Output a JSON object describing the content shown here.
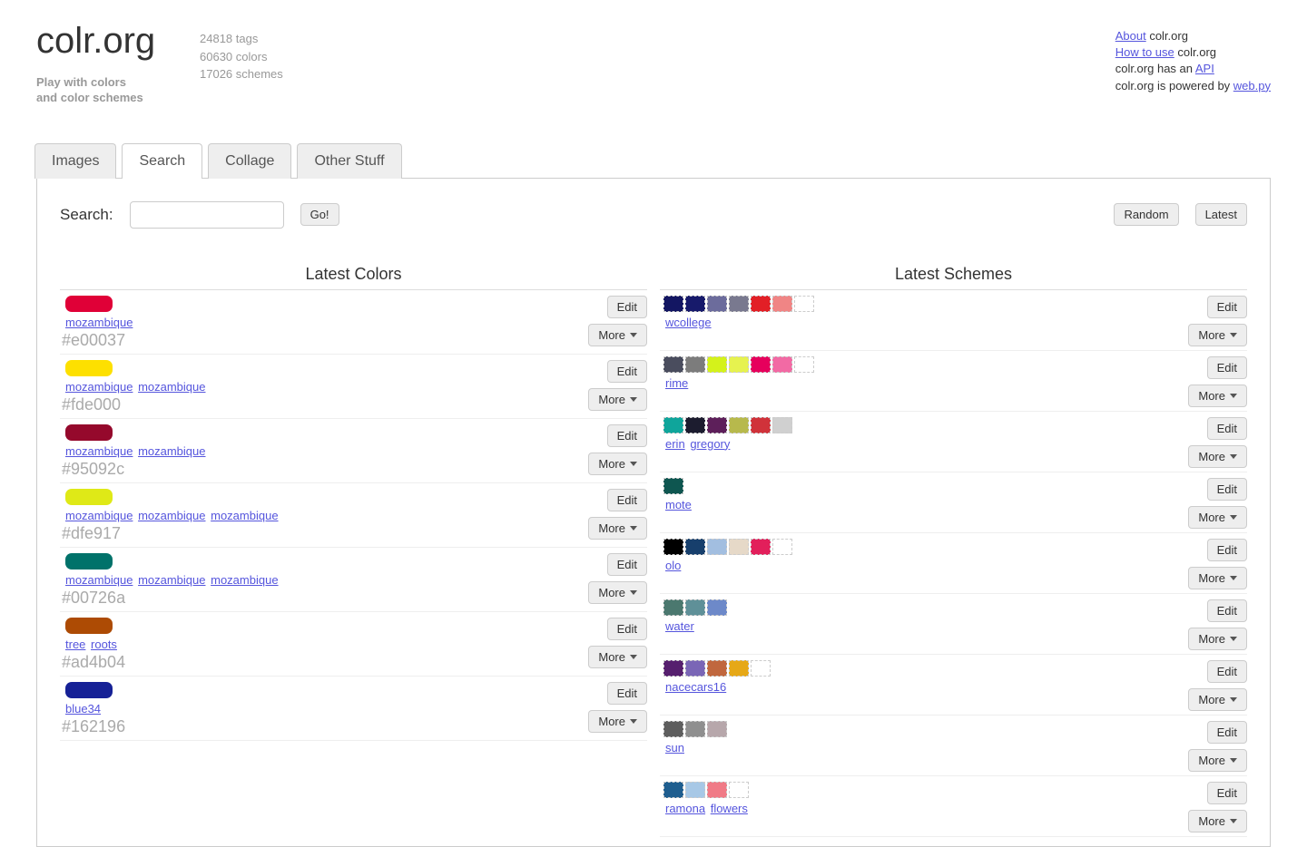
{
  "brand": {
    "title": "colr.org",
    "tagline1": "Play with colors",
    "tagline2": "and color schemes"
  },
  "stats": {
    "tags": "24818 tags",
    "colors": "60630 colors",
    "schemes": "17026 schemes"
  },
  "meta": {
    "about_link": "About",
    "about_suffix": " colr.org",
    "howto_link": "How to use",
    "howto_suffix": " colr.org",
    "api_prefix": "colr.org has an ",
    "api_link": "API",
    "powered_prefix": "colr.org is powered by ",
    "powered_link": "web.py"
  },
  "tabs": {
    "images": "Images",
    "search": "Search",
    "collage": "Collage",
    "other": "Other Stuff"
  },
  "search": {
    "label": "Search:",
    "go": "Go!",
    "random": "Random",
    "latest": "Latest"
  },
  "section_titles": {
    "colors": "Latest Colors",
    "schemes": "Latest Schemes"
  },
  "buttons": {
    "edit": "Edit",
    "more": "More"
  },
  "latest_colors": [
    {
      "hex": "#e00037",
      "tags": [
        "mozambique"
      ]
    },
    {
      "hex": "#fde000",
      "tags": [
        "mozambique",
        "mozambique"
      ]
    },
    {
      "hex": "#95092c",
      "tags": [
        "mozambique",
        "mozambique"
      ]
    },
    {
      "hex": "#dfe917",
      "tags": [
        "mozambique",
        "mozambique",
        "mozambique"
      ]
    },
    {
      "hex": "#00726a",
      "tags": [
        "mozambique",
        "mozambique",
        "mozambique"
      ]
    },
    {
      "hex": "#ad4b04",
      "tags": [
        "tree",
        "roots"
      ]
    },
    {
      "hex": "#162196",
      "tags": [
        "blue34"
      ]
    }
  ],
  "latest_schemes": [
    {
      "tags": [
        "wcollege"
      ],
      "colors": [
        "#131662",
        "#171a6b",
        "#6c6c9c",
        "#79798f",
        "#e21f26",
        "#f08585",
        "#ffffff"
      ]
    },
    {
      "tags": [
        "rime"
      ],
      "colors": [
        "#4a4d5e",
        "#7c7c7c",
        "#d4f21b",
        "#e6f24f",
        "#e6005c",
        "#f26aa4",
        "#ffffff"
      ]
    },
    {
      "tags": [
        "erin",
        "gregory"
      ],
      "colors": [
        "#0fa59b",
        "#1c1c2f",
        "#5d1f5a",
        "#b7b94c",
        "#d0323a",
        "#d0d0d0"
      ]
    },
    {
      "tags": [
        "mote"
      ],
      "colors": [
        "#0e5650"
      ]
    },
    {
      "tags": [
        "olo"
      ],
      "colors": [
        "#000000",
        "#173f6c",
        "#a2bee0",
        "#e6d9c8",
        "#e21f5b",
        "#ffffff"
      ]
    },
    {
      "tags": [
        "water"
      ],
      "colors": [
        "#4b786f",
        "#5f9098",
        "#6d89c9"
      ]
    },
    {
      "tags": [
        "nacecars16"
      ],
      "colors": [
        "#561f6e",
        "#7a66b6",
        "#c0673e",
        "#e6a817",
        "#ffffff"
      ]
    },
    {
      "tags": [
        "sun"
      ],
      "colors": [
        "#5e5e5e",
        "#8f8f8f",
        "#b7a7ab"
      ]
    },
    {
      "tags": [
        "ramona",
        "flowers"
      ],
      "colors": [
        "#1f5e8f",
        "#a7c8e6",
        "#f07a86",
        "#ffffff"
      ]
    }
  ]
}
